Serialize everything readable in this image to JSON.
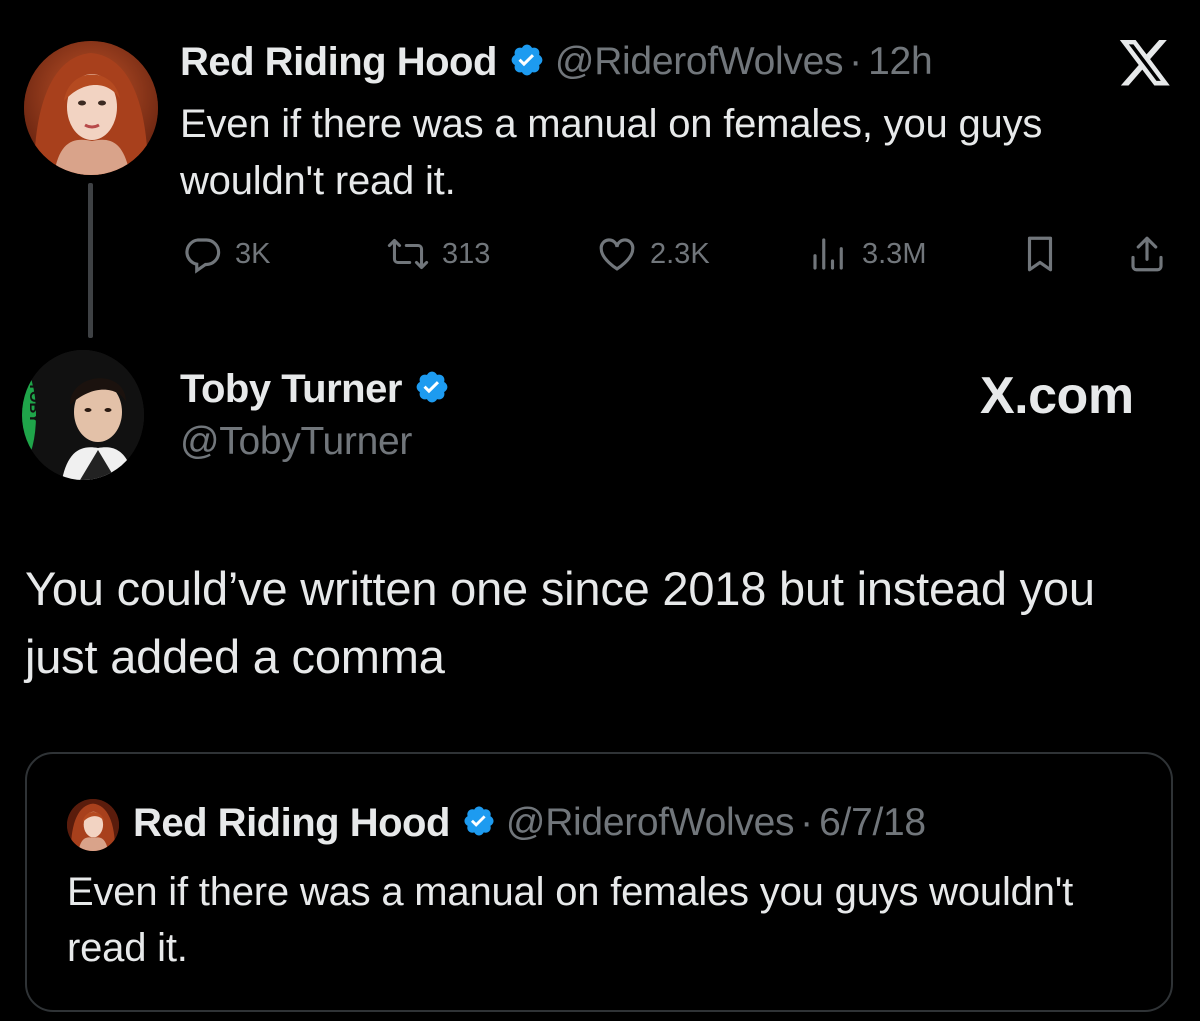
{
  "tweet": {
    "author_name": "Red Riding Hood",
    "author_handle": "@RiderofWolves",
    "separator": "·",
    "time": "12h",
    "text": "Even if there was a manual on females, you guys wouldn't read it.",
    "stats": {
      "replies": "3K",
      "retweets": "313",
      "likes": "2.3K",
      "views": "3.3M"
    }
  },
  "reply": {
    "author_name": "Toby Turner",
    "author_handle": "@TobyTurner",
    "avatar_badge": "TOBY",
    "watermark": "X.com",
    "text": "You could’ve written one since 2018 but instead you just added a comma"
  },
  "quoted": {
    "author_name": "Red Riding Hood",
    "author_handle": "@RiderofWolves",
    "separator": "·",
    "date": "6/7/18",
    "text": "Even if there was a manual on females you guys wouldn't read it."
  },
  "colors": {
    "background": "#000000",
    "primary_text": "#e7e9ea",
    "secondary_text": "#71767b",
    "verified_blue": "#1d9bf0",
    "border": "#2f3336"
  },
  "icons": [
    "verified-badge-icon",
    "x-logo-icon",
    "reply-icon",
    "retweet-icon",
    "like-icon",
    "views-icon",
    "bookmark-icon",
    "share-icon"
  ]
}
